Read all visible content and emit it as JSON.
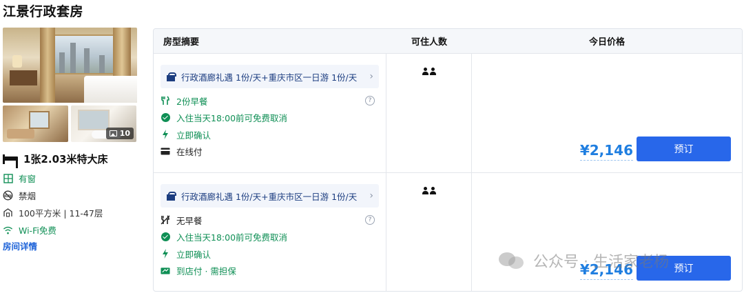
{
  "room": {
    "title": "江景行政套房",
    "photo_count": "10",
    "bed": "1张2.03米特大床",
    "amenities": [
      {
        "label": "有窗",
        "icon": "window-icon",
        "style": "green"
      },
      {
        "label": "禁烟",
        "icon": "no-smoking-icon",
        "style": "gray"
      },
      {
        "label": "100平方米 | 11-47层",
        "icon": "area-icon",
        "style": "gray"
      },
      {
        "label": "Wi-Fi免费",
        "icon": "wifi-icon",
        "style": "green"
      }
    ],
    "detail_link": "房间详情"
  },
  "table": {
    "headers": {
      "summary": "房型摘要",
      "guests": "可住人数",
      "price": "今日价格"
    },
    "rows": [
      {
        "package": "行政酒廊礼遇 1份/天+重庆市区一日游 1份/天",
        "features": [
          {
            "label": "2份早餐",
            "icon": "breakfast-icon",
            "style": "green",
            "help": "?"
          },
          {
            "label": "入住当天18:00前可免费取消",
            "icon": "check-circle-icon",
            "style": "green"
          },
          {
            "label": "立即确认",
            "icon": "lightning-icon",
            "style": "green"
          },
          {
            "label": "在线付",
            "icon": "card-icon",
            "style": "dark"
          }
        ],
        "guests": 2,
        "price": "¥2,146",
        "book": "预订"
      },
      {
        "package": "行政酒廊礼遇 1份/天+重庆市区一日游 1份/天",
        "features": [
          {
            "label": "无早餐",
            "icon": "no-breakfast-icon",
            "style": "dark",
            "help": "?"
          },
          {
            "label": "入住当天18:00前可免费取消",
            "icon": "check-circle-icon",
            "style": "green"
          },
          {
            "label": "立即确认",
            "icon": "lightning-icon",
            "style": "green"
          },
          {
            "label": "到店付 · 需担保",
            "icon": "pay-at-hotel-icon",
            "style": "green"
          }
        ],
        "guests": 2,
        "price": "¥2,146",
        "book": "预订"
      }
    ]
  },
  "watermark": "公众号 · 生活家老杨",
  "colors": {
    "accent": "#2867ea",
    "price": "#1f7ee0",
    "green": "#0f8f55",
    "chip_text": "#1c3d80"
  }
}
